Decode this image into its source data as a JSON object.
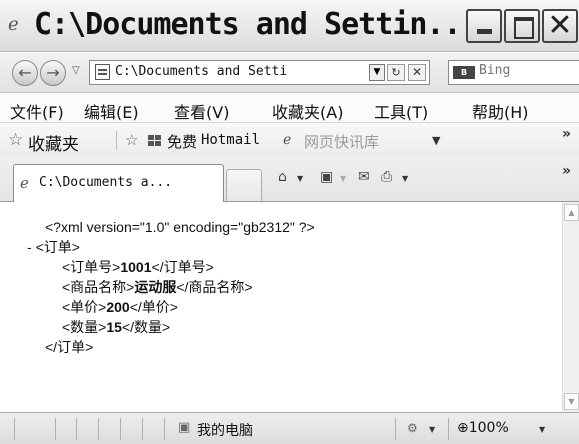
{
  "window": {
    "title": "C:\\Documents and Settin..."
  },
  "address": {
    "url": "C:\\Documents and Setti",
    "search_placeholder": "Bing",
    "search_brand": "Bing"
  },
  "menu": {
    "items": [
      "文件(F)",
      "编辑(E)",
      "查看(V)",
      "收藏夹(A)",
      "工具(T)",
      "帮助(H)"
    ]
  },
  "favorites": {
    "label": "收藏夹",
    "link_free": "免费",
    "link_hotmail": "Hotmail",
    "webslice_gallery": "网页快讯库"
  },
  "tab": {
    "title": "C:\\Documents a..."
  },
  "xml": {
    "declaration": "<?xml version=\"1.0\" encoding=\"gb2312\" ?>",
    "collapse": "- ",
    "root_open": "<订单>",
    "order_no_open": "<订单号>",
    "order_no_value": "1001",
    "order_no_close": "</订单号>",
    "product_open": "<商品名称>",
    "product_value": "运动服",
    "product_close": "</商品名称>",
    "price_open": "<单价>",
    "price_value": "200",
    "price_close": "</单价>",
    "qty_open": "<数量>",
    "qty_value": "15",
    "qty_close": "</数量>",
    "root_close": "</订单>"
  },
  "status": {
    "zone": "我的电脑",
    "zoom": "100%"
  }
}
